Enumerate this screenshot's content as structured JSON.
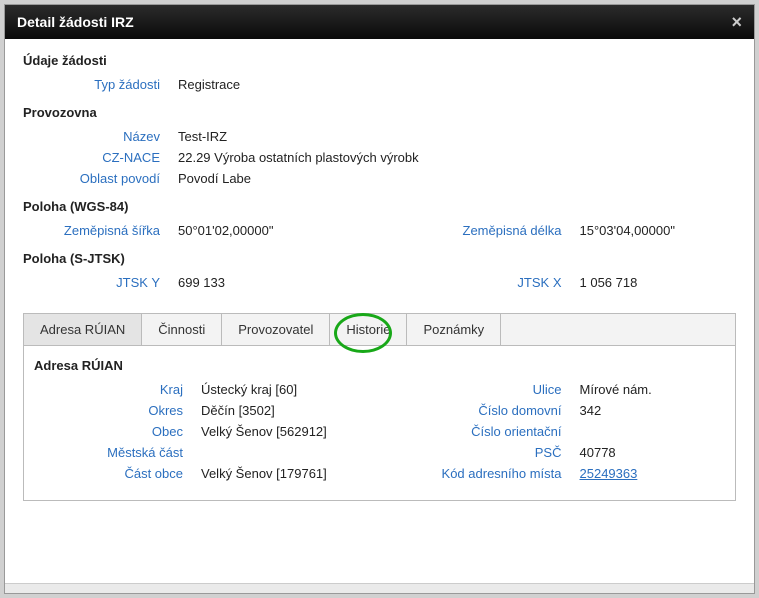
{
  "header": {
    "title": "Detail žádosti IRZ",
    "close_label": "×"
  },
  "sections": {
    "request": {
      "title": "Údaje žádosti",
      "type_label": "Typ žádosti",
      "type_value": "Registrace"
    },
    "plant": {
      "title": "Provozovna",
      "name_label": "Název",
      "name_value": "Test-IRZ",
      "nace_label": "CZ-NACE",
      "nace_value": "22.29 Výroba ostatních plastových výrobk",
      "basin_label": "Oblast povodí",
      "basin_value": "Povodí Labe"
    },
    "wgs84": {
      "title": "Poloha (WGS-84)",
      "lat_label": "Zeměpisná šířka",
      "lat_value": "50°01'02,00000\"",
      "lon_label": "Zeměpisná délka",
      "lon_value": "15°03'04,00000\""
    },
    "sjtsk": {
      "title": "Poloha (S-JTSK)",
      "y_label": "JTSK Y",
      "y_value": "699 133",
      "x_label": "JTSK X",
      "x_value": "1 056 718"
    }
  },
  "tabs": {
    "addr": "Adresa RÚIAN",
    "acts": "Činnosti",
    "oper": "Provozovatel",
    "hist": "Historie",
    "notes": "Poznámky"
  },
  "address": {
    "title": "Adresa RÚIAN",
    "left": {
      "kraj_label": "Kraj",
      "kraj_value": "Ústecký kraj [60]",
      "okres_label": "Okres",
      "okres_value": "Děčín [3502]",
      "obec_label": "Obec",
      "obec_value": "Velký Šenov [562912]",
      "mestska_label": "Městská část",
      "mestska_value": "",
      "cast_label": "Část obce",
      "cast_value": "Velký Šenov [179761]"
    },
    "right": {
      "ulice_label": "Ulice",
      "ulice_value": "Mírové nám.",
      "domovni_label": "Číslo domovní",
      "domovni_value": "342",
      "orient_label": "Číslo orientační",
      "orient_value": "",
      "psc_label": "PSČ",
      "psc_value": "40778",
      "kod_label": "Kód adresního místa",
      "kod_value": "25249363"
    }
  }
}
